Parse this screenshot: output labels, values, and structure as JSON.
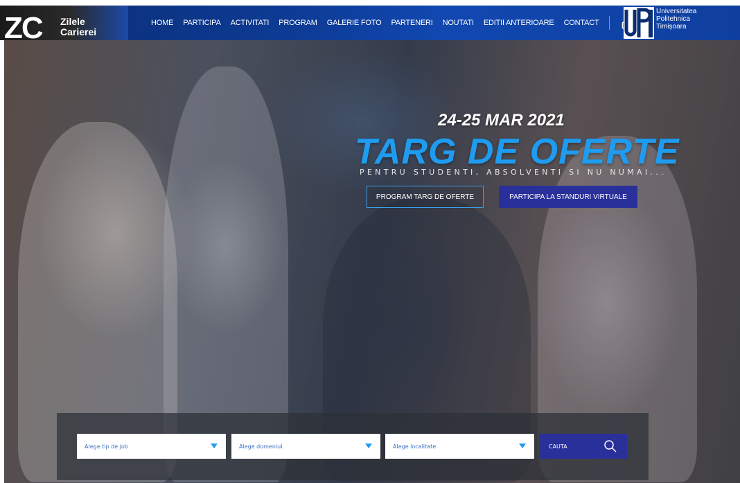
{
  "logo": {
    "initials": "ZC",
    "line1": "Zilele",
    "line2": "Carierei"
  },
  "nav": {
    "items": [
      "HOME",
      "PARTICIPA",
      "ACTIVITATI",
      "PROGRAM",
      "GALERIE FOTO",
      "PARTENERI",
      "NOUTATI",
      "EDITII ANTERIOARE",
      "CONTACT"
    ],
    "login_icon": "lock-icon"
  },
  "university": {
    "line1": "Universitatea",
    "line2": "Politehnica",
    "line3": "Timișoara"
  },
  "hero": {
    "date": "24-25 MAR 2021",
    "title": "TARG DE OFERTE",
    "subtitle": "PENTRU STUDENTI, ABSOLVENTI SI NU NUMAI...",
    "btn_program": "PROGRAM TARG DE OFERTE",
    "btn_participa": "PARTICIPA LA STANDURI VIRTUALE"
  },
  "search": {
    "job_type_placeholder": "Alege tip de job",
    "domain_placeholder": "Alege domeniul",
    "location_placeholder": "Alege localitate",
    "submit_label": "CAUTA",
    "submit_icon": "search-icon"
  },
  "colors": {
    "nav_blue": "#0d3b95",
    "accent_blue": "#1f9cf0",
    "button_indigo": "#29309a"
  }
}
